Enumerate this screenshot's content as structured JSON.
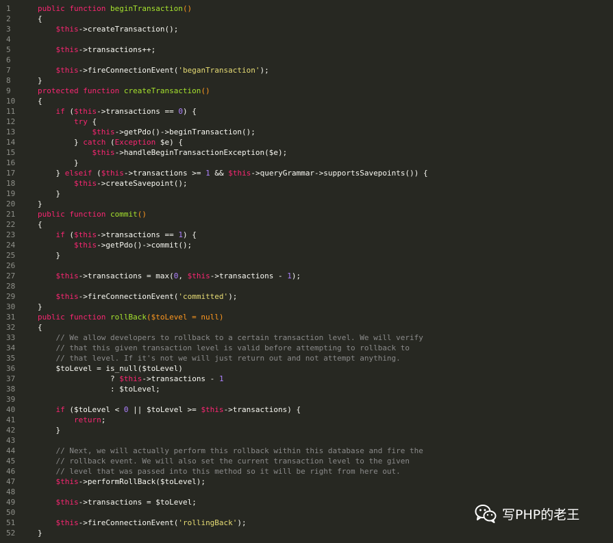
{
  "colors": {
    "background": "#272822",
    "line_number": "#8f908a",
    "keyword": "#f92672",
    "function_name": "#a6e22e",
    "parens": "#fd971f",
    "string": "#e6db74",
    "number": "#ae81ff",
    "comment": "#8a8a8a",
    "plain": "#f8f8f2"
  },
  "editor": {
    "lines": [
      {
        "n": "1",
        "tokens": [
          {
            "t": "public function ",
            "c": "keyword"
          },
          {
            "t": "beginTransaction",
            "c": "func"
          },
          {
            "t": "()",
            "c": "paren"
          }
        ]
      },
      {
        "n": "2",
        "tokens": [
          {
            "t": "{",
            "c": "plain"
          }
        ]
      },
      {
        "n": "3",
        "tokens": [
          {
            "t": "    ",
            "c": "plain"
          },
          {
            "t": "$this",
            "c": "var"
          },
          {
            "t": "->createTransaction();",
            "c": "plain"
          }
        ]
      },
      {
        "n": "4",
        "tokens": []
      },
      {
        "n": "5",
        "tokens": [
          {
            "t": "    ",
            "c": "plain"
          },
          {
            "t": "$this",
            "c": "var"
          },
          {
            "t": "->transactions++;",
            "c": "plain"
          }
        ]
      },
      {
        "n": "6",
        "tokens": []
      },
      {
        "n": "7",
        "tokens": [
          {
            "t": "    ",
            "c": "plain"
          },
          {
            "t": "$this",
            "c": "var"
          },
          {
            "t": "->fireConnectionEvent(",
            "c": "plain"
          },
          {
            "t": "'beganTransaction'",
            "c": "string"
          },
          {
            "t": ");",
            "c": "plain"
          }
        ]
      },
      {
        "n": "8",
        "tokens": [
          {
            "t": "}",
            "c": "plain"
          }
        ]
      },
      {
        "n": "9",
        "tokens": [
          {
            "t": "protected function ",
            "c": "keyword"
          },
          {
            "t": "createTransaction",
            "c": "func"
          },
          {
            "t": "()",
            "c": "paren"
          }
        ]
      },
      {
        "n": "10",
        "tokens": [
          {
            "t": "{",
            "c": "plain"
          }
        ]
      },
      {
        "n": "11",
        "tokens": [
          {
            "t": "    ",
            "c": "plain"
          },
          {
            "t": "if",
            "c": "keyword"
          },
          {
            "t": " (",
            "c": "plain"
          },
          {
            "t": "$this",
            "c": "var"
          },
          {
            "t": "->transactions == ",
            "c": "plain"
          },
          {
            "t": "0",
            "c": "num"
          },
          {
            "t": ") {",
            "c": "plain"
          }
        ]
      },
      {
        "n": "12",
        "tokens": [
          {
            "t": "        ",
            "c": "plain"
          },
          {
            "t": "try",
            "c": "keyword"
          },
          {
            "t": " {",
            "c": "plain"
          }
        ]
      },
      {
        "n": "13",
        "tokens": [
          {
            "t": "            ",
            "c": "plain"
          },
          {
            "t": "$this",
            "c": "var"
          },
          {
            "t": "->getPdo()->beginTransaction();",
            "c": "plain"
          }
        ]
      },
      {
        "n": "14",
        "tokens": [
          {
            "t": "        } ",
            "c": "plain"
          },
          {
            "t": "catch",
            "c": "keyword"
          },
          {
            "t": " (",
            "c": "plain"
          },
          {
            "t": "Exception",
            "c": "keyword"
          },
          {
            "t": " $e) {",
            "c": "plain"
          }
        ]
      },
      {
        "n": "15",
        "tokens": [
          {
            "t": "            ",
            "c": "plain"
          },
          {
            "t": "$this",
            "c": "var"
          },
          {
            "t": "->handleBeginTransactionException($e);",
            "c": "plain"
          }
        ]
      },
      {
        "n": "16",
        "tokens": [
          {
            "t": "        }",
            "c": "plain"
          }
        ]
      },
      {
        "n": "17",
        "tokens": [
          {
            "t": "    } ",
            "c": "plain"
          },
          {
            "t": "elseif",
            "c": "keyword"
          },
          {
            "t": " (",
            "c": "plain"
          },
          {
            "t": "$this",
            "c": "var"
          },
          {
            "t": "->transactions >= ",
            "c": "plain"
          },
          {
            "t": "1",
            "c": "num"
          },
          {
            "t": " && ",
            "c": "plain"
          },
          {
            "t": "$this",
            "c": "var"
          },
          {
            "t": "->queryGrammar->supportsSavepoints()) {",
            "c": "plain"
          }
        ]
      },
      {
        "n": "18",
        "tokens": [
          {
            "t": "        ",
            "c": "plain"
          },
          {
            "t": "$this",
            "c": "var"
          },
          {
            "t": "->createSavepoint();",
            "c": "plain"
          }
        ]
      },
      {
        "n": "19",
        "tokens": [
          {
            "t": "    }",
            "c": "plain"
          }
        ]
      },
      {
        "n": "20",
        "tokens": [
          {
            "t": "}",
            "c": "plain"
          }
        ]
      },
      {
        "n": "21",
        "tokens": [
          {
            "t": "public function ",
            "c": "keyword"
          },
          {
            "t": "commit",
            "c": "func"
          },
          {
            "t": "()",
            "c": "paren"
          }
        ]
      },
      {
        "n": "22",
        "tokens": [
          {
            "t": "{",
            "c": "plain"
          }
        ]
      },
      {
        "n": "23",
        "tokens": [
          {
            "t": "    ",
            "c": "plain"
          },
          {
            "t": "if",
            "c": "keyword"
          },
          {
            "t": " (",
            "c": "plain"
          },
          {
            "t": "$this",
            "c": "var"
          },
          {
            "t": "->transactions == ",
            "c": "plain"
          },
          {
            "t": "1",
            "c": "num"
          },
          {
            "t": ") {",
            "c": "plain"
          }
        ]
      },
      {
        "n": "24",
        "tokens": [
          {
            "t": "        ",
            "c": "plain"
          },
          {
            "t": "$this",
            "c": "var"
          },
          {
            "t": "->getPdo()->commit();",
            "c": "plain"
          }
        ]
      },
      {
        "n": "25",
        "tokens": [
          {
            "t": "    }",
            "c": "plain"
          }
        ]
      },
      {
        "n": "26",
        "tokens": []
      },
      {
        "n": "27",
        "tokens": [
          {
            "t": "    ",
            "c": "plain"
          },
          {
            "t": "$this",
            "c": "var"
          },
          {
            "t": "->transactions = max(",
            "c": "plain"
          },
          {
            "t": "0",
            "c": "num"
          },
          {
            "t": ", ",
            "c": "plain"
          },
          {
            "t": "$this",
            "c": "var"
          },
          {
            "t": "->transactions - ",
            "c": "plain"
          },
          {
            "t": "1",
            "c": "num"
          },
          {
            "t": ");",
            "c": "plain"
          }
        ]
      },
      {
        "n": "28",
        "tokens": []
      },
      {
        "n": "29",
        "tokens": [
          {
            "t": "    ",
            "c": "plain"
          },
          {
            "t": "$this",
            "c": "var"
          },
          {
            "t": "->fireConnectionEvent(",
            "c": "plain"
          },
          {
            "t": "'committed'",
            "c": "string"
          },
          {
            "t": ");",
            "c": "plain"
          }
        ]
      },
      {
        "n": "30",
        "tokens": [
          {
            "t": "}",
            "c": "plain"
          }
        ]
      },
      {
        "n": "31",
        "tokens": [
          {
            "t": "public function ",
            "c": "keyword"
          },
          {
            "t": "rollBack",
            "c": "func"
          },
          {
            "t": "($toLevel = null)",
            "c": "paren"
          }
        ]
      },
      {
        "n": "32",
        "tokens": [
          {
            "t": "{",
            "c": "plain"
          }
        ]
      },
      {
        "n": "33",
        "tokens": [
          {
            "t": "    // We allow developers to rollback to a certain transaction level. We will verify",
            "c": "comment"
          }
        ]
      },
      {
        "n": "34",
        "tokens": [
          {
            "t": "    // that this given transaction level is valid before attempting to rollback to",
            "c": "comment"
          }
        ]
      },
      {
        "n": "35",
        "tokens": [
          {
            "t": "    // that level. If it's not we will just return out and not attempt anything.",
            "c": "comment"
          }
        ]
      },
      {
        "n": "36",
        "tokens": [
          {
            "t": "    $toLevel = is_null($toLevel)",
            "c": "plain"
          }
        ]
      },
      {
        "n": "37",
        "tokens": [
          {
            "t": "                ? ",
            "c": "plain"
          },
          {
            "t": "$this",
            "c": "var"
          },
          {
            "t": "->transactions - ",
            "c": "plain"
          },
          {
            "t": "1",
            "c": "num"
          }
        ]
      },
      {
        "n": "38",
        "tokens": [
          {
            "t": "                : $toLevel;",
            "c": "plain"
          }
        ]
      },
      {
        "n": "39",
        "tokens": []
      },
      {
        "n": "40",
        "tokens": [
          {
            "t": "    ",
            "c": "plain"
          },
          {
            "t": "if",
            "c": "keyword"
          },
          {
            "t": " ($toLevel < ",
            "c": "plain"
          },
          {
            "t": "0",
            "c": "num"
          },
          {
            "t": " || $toLevel >= ",
            "c": "plain"
          },
          {
            "t": "$this",
            "c": "var"
          },
          {
            "t": "->transactions) {",
            "c": "plain"
          }
        ]
      },
      {
        "n": "41",
        "tokens": [
          {
            "t": "        ",
            "c": "plain"
          },
          {
            "t": "return",
            "c": "keyword"
          },
          {
            "t": ";",
            "c": "plain"
          }
        ]
      },
      {
        "n": "42",
        "tokens": [
          {
            "t": "    }",
            "c": "plain"
          }
        ]
      },
      {
        "n": "43",
        "tokens": []
      },
      {
        "n": "44",
        "tokens": [
          {
            "t": "    // Next, we will actually perform this rollback within this database and fire the",
            "c": "comment"
          }
        ]
      },
      {
        "n": "45",
        "tokens": [
          {
            "t": "    // rollback event. We will also set the current transaction level to the given",
            "c": "comment"
          }
        ]
      },
      {
        "n": "46",
        "tokens": [
          {
            "t": "    // level that was passed into this method so it will be right from here out.",
            "c": "comment"
          }
        ]
      },
      {
        "n": "47",
        "tokens": [
          {
            "t": "    ",
            "c": "plain"
          },
          {
            "t": "$this",
            "c": "var"
          },
          {
            "t": "->performRollBack($toLevel);",
            "c": "plain"
          }
        ]
      },
      {
        "n": "48",
        "tokens": []
      },
      {
        "n": "49",
        "tokens": [
          {
            "t": "    ",
            "c": "plain"
          },
          {
            "t": "$this",
            "c": "var"
          },
          {
            "t": "->transactions = $toLevel;",
            "c": "plain"
          }
        ]
      },
      {
        "n": "50",
        "tokens": []
      },
      {
        "n": "51",
        "tokens": [
          {
            "t": "    ",
            "c": "plain"
          },
          {
            "t": "$this",
            "c": "var"
          },
          {
            "t": "->fireConnectionEvent(",
            "c": "plain"
          },
          {
            "t": "'rollingBack'",
            "c": "string"
          },
          {
            "t": ");",
            "c": "plain"
          }
        ]
      },
      {
        "n": "52",
        "tokens": [
          {
            "t": "}",
            "c": "plain"
          }
        ]
      }
    ]
  },
  "watermark": {
    "icon": "wechat-icon",
    "text": "写PHP的老王"
  }
}
